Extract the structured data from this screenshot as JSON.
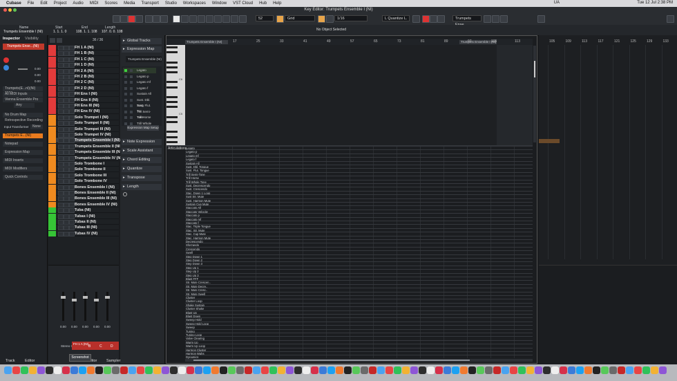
{
  "menubar": {
    "items": [
      "Cubase",
      "File",
      "Edit",
      "Project",
      "Audio",
      "MIDI",
      "Scores",
      "Media",
      "Transport",
      "Studio",
      "Workspaces",
      "Window",
      "VST Cloud",
      "Hub",
      "Help"
    ],
    "clock": "Tue 12 Jul  2:38 PM",
    "lang": "UA"
  },
  "window": {
    "title": "Key Editor: Trumpets Ensemble I (NI)"
  },
  "toolbar": {
    "quantize_value": "52",
    "grid_label": "Grid",
    "grid_value": "1/16",
    "quantize_mode": "L  Quantize L.",
    "track_select": "Trumpets Ense.."
  },
  "infoline": {
    "name_label": "Name",
    "name_value": "Trumpets Ensemble I (NI)",
    "start_label": "Start",
    "start_value": "1. 1. 1. 0",
    "end_label": "End",
    "end_value": "108. 1. 1. 108",
    "length_label": "Length",
    "length_value": "107. 0. 0. 108",
    "status": "No Object Selected"
  },
  "inspector": {
    "tabs": [
      "Inspector",
      "Visibility"
    ],
    "track_name": "Trumpets Ense...(NI)",
    "values": [
      "0.00",
      "0.00",
      "0.00"
    ],
    "routing": [
      "Trumpets(E...nI)(NI) 2022",
      "All MIDI Inputs",
      "Vienna Ensemble Pro",
      "Any"
    ],
    "drum_map": "No Drum Map",
    "retro_record": "Retrospective Recording",
    "input_transformer": "Input Transformer",
    "input_transformer_value": "None",
    "sections": [
      {
        "label": "Trumpets E...(NI)"
      },
      {
        "label": "Notepad"
      },
      {
        "label": "Expression Map"
      },
      {
        "label": "MIDI Inserts"
      },
      {
        "label": "MIDI Modifiers"
      },
      {
        "label": "Quick Controls"
      }
    ]
  },
  "tracklist": {
    "counter": "36 / 36",
    "tracks": [
      {
        "name": "FH 1 A (NI)",
        "color": "#e23b3b"
      },
      {
        "name": "FH 1 B (NI)",
        "color": "#e23b3b"
      },
      {
        "name": "FH 1 C (NI)",
        "color": "#e23b3b"
      },
      {
        "name": "FH 1 D (NI)",
        "color": "#e23b3b"
      },
      {
        "name": "FH 2 A (NI)",
        "color": "#e23b3b"
      },
      {
        "name": "FH 2 B (NI)",
        "color": "#e23b3b"
      },
      {
        "name": "FH 2 C (NI)",
        "color": "#e23b3b"
      },
      {
        "name": "FH 2 D (NI)",
        "color": "#e23b3b"
      },
      {
        "name": "FH Ens I (NI)",
        "color": "#e23b3b"
      },
      {
        "name": "FH Ens II (NI)",
        "color": "#e23b3b"
      },
      {
        "name": "FH Ens III (NI)",
        "color": "#e23b3b"
      },
      {
        "name": "FH Ens IV (NI)",
        "color": "#e23b3b"
      },
      {
        "name": "Solo Trumpet I (NI)",
        "color": "#ef8a1f"
      },
      {
        "name": "Solo Trumpet II (NI)",
        "color": "#ef8a1f"
      },
      {
        "name": "Solo Trumpet III (NI)",
        "color": "#ef8a1f"
      },
      {
        "name": "Solo Trumpet IV (NI)",
        "color": "#ef8a1f"
      },
      {
        "name": "Trumpets Ensemble I (NI)",
        "color": "#ef8a1f",
        "selected": true
      },
      {
        "name": "Trumpets Ensemble II (NI)",
        "color": "#ef8a1f"
      },
      {
        "name": "Trumpets Ensemble III (NI)",
        "color": "#ef8a1f"
      },
      {
        "name": "Trumpets Ensemble IV (NI)",
        "color": "#ef8a1f"
      },
      {
        "name": "Solo Trombone I",
        "color": "#ef8a1f"
      },
      {
        "name": "Solo Trombone II",
        "color": "#ef8a1f"
      },
      {
        "name": "Solo Trombone III",
        "color": "#ef8a1f"
      },
      {
        "name": "Solo Trombone IV",
        "color": "#ef8a1f"
      },
      {
        "name": "Bones Ensemble I (NI)",
        "color": "#ef8a1f"
      },
      {
        "name": "Bones Ensemble II (NI)",
        "color": "#ef8a1f"
      },
      {
        "name": "Bones Ensemble III (NI)",
        "color": "#ef8a1f"
      },
      {
        "name": "Bones Ensemble IV (NI)",
        "color": "#ef8a1f"
      },
      {
        "name": "Tuba (NI)",
        "color": "#36c436"
      },
      {
        "name": "Tubas I (NI)",
        "color": "#36c436"
      },
      {
        "name": "Tubas II (NI)",
        "color": "#36c436"
      },
      {
        "name": "Tubas III (NI)",
        "color": "#36c436"
      },
      {
        "name": "Tubas IV (NI)",
        "color": "#36c436"
      }
    ]
  },
  "keypanel": {
    "sections": [
      "Global Tracks",
      "Expression Map",
      "Note Expression",
      "Scale Assistant",
      "Chord Editing",
      "Quantize",
      "Transpose",
      "Length"
    ],
    "expmap_name": "Trumpets Ensemble (NI)",
    "expmap_setup": "Expression Map Setup",
    "articulations": [
      "Legato",
      "Legato p",
      "Legato mf",
      "Legato f",
      "Sustain All",
      "Sust. Dbl. Tong",
      "Sust. Flut. To..",
      "Trill Semi-Tone",
      "Trill Horse",
      "Trill Whole To.."
    ]
  },
  "ruler": {
    "left_label": "Trumpets Ensemble I (NI)",
    "right_label": "Trumpets Ensemble I (NI)",
    "numbers": [
      "17",
      "25",
      "33",
      "41",
      "49",
      "57",
      "65",
      "73",
      "81",
      "89",
      "97",
      "105",
      "113"
    ]
  },
  "piano": {
    "labels": [
      "C6",
      "C5"
    ]
  },
  "lanes": {
    "title": "Articulations",
    "items": [
      "Legato",
      "Legato p",
      "Legato mf",
      "Legato f",
      "Sustain All",
      "Sust. Dbl. Tongue",
      "Sust. Flut. Tongue",
      "Trill Semi-Tone",
      "Trill Horse",
      "Trill Whole Tone",
      "Sust. Decrescendo",
      "Sust. Crescendo",
      "Stac. Down 1 Loop",
      "Sust Str. Mute",
      "Sust. Harmon Mute",
      "Sustain Cup Mute",
      "Staccato All",
      "Staccato Velocity",
      "Staccato p",
      "Staccato mf",
      "Staccato f",
      "Stac. Triple Tongue",
      "Stac. Str. Mute",
      "Stac. Cup Mute",
      "Stac. Harmon Mute",
      "Decrescendo",
      "Sforzando",
      "Crescendo",
      "Swell",
      "Step Down 1",
      "Step Down 2",
      "Step Down 3",
      "Step Up 1",
      "Step Up 2",
      "Step Up 3",
      "Blast FFF",
      "Str. Mute Crescen..",
      "Str. Mute Decre..",
      "Str. Mute Cresc..",
      "Str. Mute Swell",
      "Cluster",
      "Cluster Loop",
      "Shake Sustain",
      "Cluster Shake",
      "Blast Up",
      "Blast Down",
      "Sweep Hold",
      "Sweep Hold Loop",
      "Sweep",
      "Tuning",
      "Tuning Loop",
      "Valve Clearing",
      "Warm Up",
      "Warm Up Loop",
      "Harmon Cluster",
      "Harmon Wahs",
      "Dynamics"
    ]
  },
  "arrange": {
    "numbers": [
      "105",
      "109",
      "113",
      "117",
      "121",
      "125",
      "129",
      "133"
    ]
  },
  "mixer": {
    "values": [
      "0.00",
      "0.00",
      "0.00",
      "0.00",
      "0.00"
    ],
    "route": "Stereo In",
    "channel_labels": [
      "FH 1 A (NI)",
      "B",
      "C",
      "D"
    ]
  },
  "bottom": {
    "tabs": [
      "Track",
      "Editor",
      "Editor",
      "Sampler"
    ],
    "tooltip": "Screenshot"
  },
  "colors": {
    "accent_red": "#e23b3b",
    "accent_orange": "#ef8a1f",
    "accent_green": "#36c436",
    "note_bar": "#6b4a2a"
  }
}
